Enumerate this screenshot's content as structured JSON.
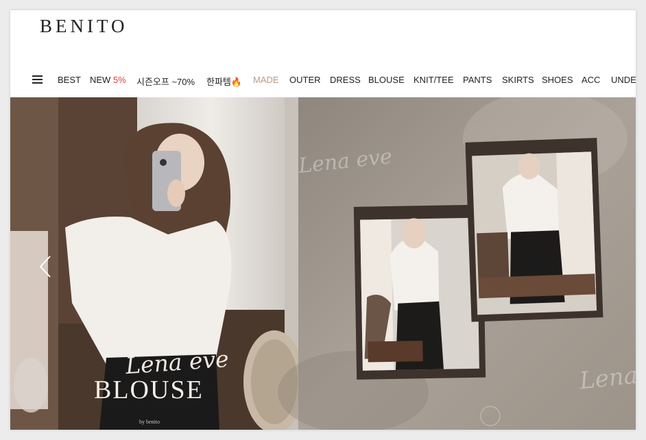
{
  "brand": {
    "logo_text": "BENITO"
  },
  "nav": {
    "menu_icon": "hamburger-menu-icon",
    "items": [
      {
        "label": "BEST"
      },
      {
        "label": "NEW",
        "badge": "5%"
      },
      {
        "label": "시즌오프 ~70%"
      },
      {
        "label": "한파템🔥"
      },
      {
        "label": "MADE"
      },
      {
        "label": "OUTER"
      },
      {
        "label": "DRESS"
      },
      {
        "label": "BLOUSE"
      },
      {
        "label": "KNIT/TEE"
      },
      {
        "label": "PANTS"
      },
      {
        "label": "SKIRTS"
      },
      {
        "label": "SHOES"
      },
      {
        "label": "ACC"
      },
      {
        "label": "UNDE"
      }
    ]
  },
  "banner": {
    "signature": "Lena eve",
    "title": "BLOUSE",
    "byline": "by benito",
    "script_left": "Lena eve",
    "script_right": "Lena",
    "prev_icon": "chevron-left-icon",
    "colors": {
      "badge_red": "#e53935",
      "made_label": "#b89b85",
      "right_bg": "#a39b91"
    }
  }
}
